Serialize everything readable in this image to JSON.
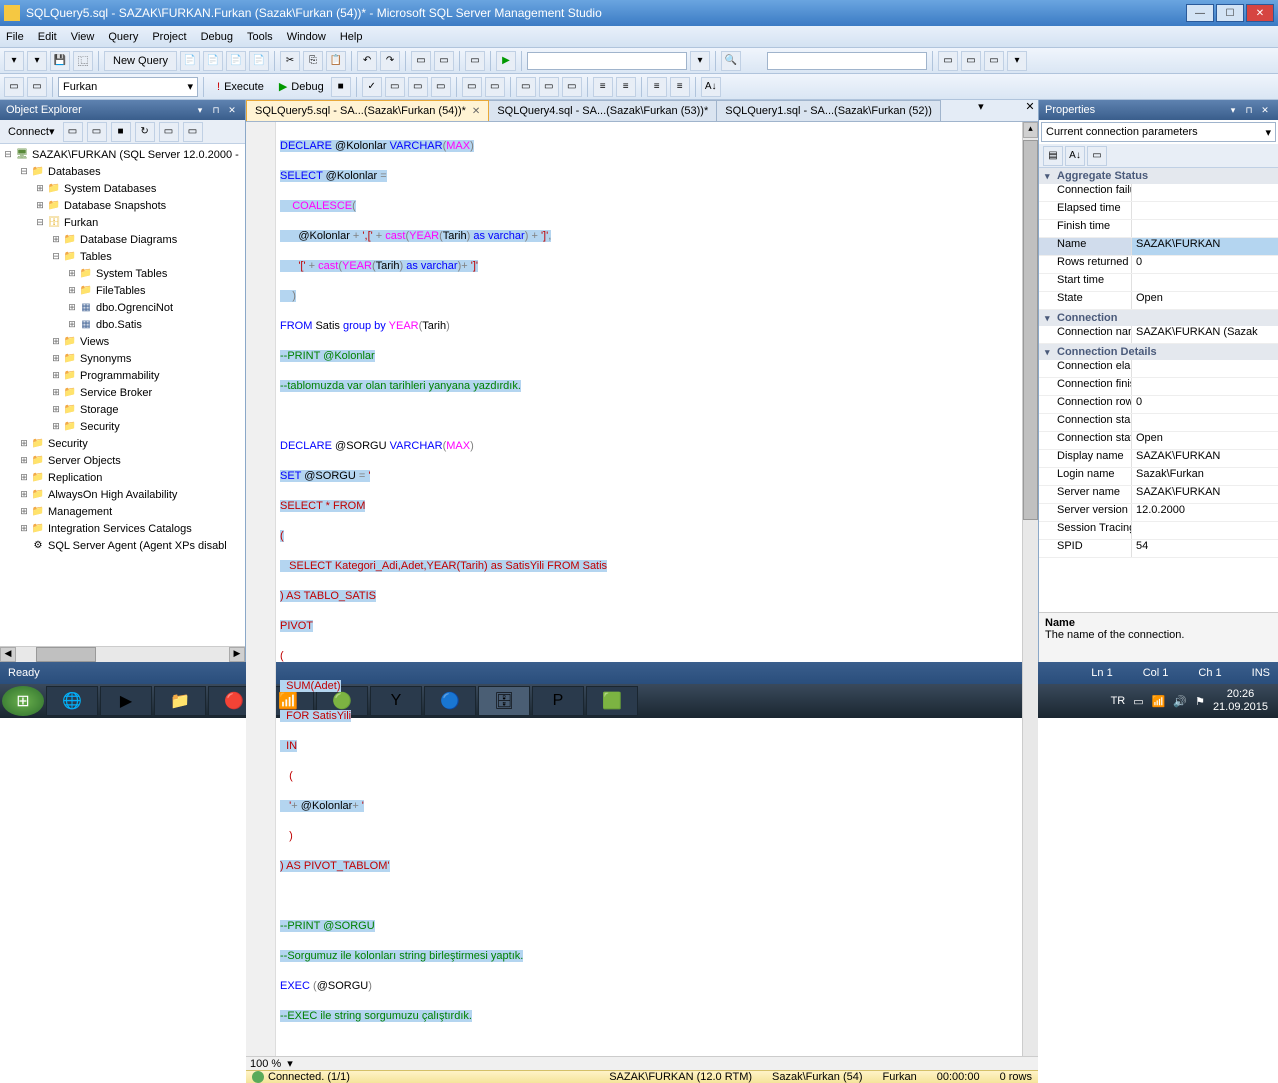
{
  "window": {
    "title": "SQLQuery5.sql - SAZAK\\FURKAN.Furkan (Sazak\\Furkan (54))* - Microsoft SQL Server Management Studio"
  },
  "menu": {
    "file": "File",
    "edit": "Edit",
    "view": "View",
    "query": "Query",
    "project": "Project",
    "debug": "Debug",
    "tools": "Tools",
    "window": "Window",
    "help": "Help"
  },
  "toolbar": {
    "newquery": "New Query",
    "database": "Furkan",
    "execute": "Execute",
    "debug": "Debug"
  },
  "objexplorer": {
    "title": "Object Explorer",
    "connect": "Connect",
    "server": "SAZAK\\FURKAN (SQL Server 12.0.2000 -",
    "databases": "Databases",
    "sysdb": "System Databases",
    "dbsnap": "Database Snapshots",
    "furkan": "Furkan",
    "dbdiagrams": "Database Diagrams",
    "tables": "Tables",
    "systables": "System Tables",
    "filetables": "FileTables",
    "ogrencinot": "dbo.OgrenciNot",
    "satis": "dbo.Satis",
    "views": "Views",
    "synonyms": "Synonyms",
    "programmability": "Programmability",
    "servicebroker": "Service Broker",
    "storage": "Storage",
    "security": "Security",
    "security2": "Security",
    "serverobjects": "Server Objects",
    "replication": "Replication",
    "alwayson": "AlwaysOn High Availability",
    "management": "Management",
    "isc": "Integration Services Catalogs",
    "agent": "SQL Server Agent (Agent XPs disabl"
  },
  "tabs": {
    "t1": "SQLQuery5.sql - SA...(Sazak\\Furkan (54))*",
    "t2": "SQLQuery4.sql - SA...(Sazak\\Furkan (53))*",
    "t3": "SQLQuery1.sql - SA...(Sazak\\Furkan (52))"
  },
  "code": {
    "l1a": "DECLARE",
    "l1b": " @Kolonlar ",
    "l1c": "VARCHAR",
    "l1d": "(",
    "l1e": "MAX",
    "l1f": ")",
    "l2a": "SELECT",
    "l2b": " @Kolonlar ",
    "l2c": "=",
    "l3a": "    COALESCE",
    "l3b": "(",
    "l4a": "      @Kolonlar ",
    "l4b": "+",
    "l4c": " ',['",
    "l4d": " + ",
    "l4e": "cast",
    "l4f": "(",
    "l4g": "YEAR",
    "l4h": "(",
    "l4i": "Tarih",
    "l4j": ")",
    "l4k": " as ",
    "l4l": "varchar",
    "l4m": ")",
    "l4n": " + ",
    "l4o": "']'",
    "l4p": ",",
    "l5a": "      '['",
    "l5b": " + ",
    "l5c": "cast",
    "l5d": "(",
    "l5e": "YEAR",
    "l5f": "(",
    "l5g": "Tarih",
    "l5h": ")",
    "l5i": " as ",
    "l5j": "varchar",
    "l5k": ")",
    "l5l": "+ ",
    "l5m": "']'",
    "l6a": "    )",
    "l7a": "FROM",
    "l7b": " Satis ",
    "l7c": "group",
    "l7d": " by ",
    "l7e": "YEAR",
    "l7f": "(",
    "l7g": "Tarih",
    "l7h": ")",
    "l8": "--PRINT @Kolonlar",
    "l9": "--tablomuzda var olan tarihleri yanyana yazdırdık.",
    "l11a": "DECLARE",
    "l11b": " @SORGU ",
    "l11c": "VARCHAR",
    "l11d": "(",
    "l11e": "MAX",
    "l11f": ")",
    "l12a": "SET",
    "l12b": " @SORGU ",
    "l12c": "=",
    "l12d": " '",
    "l13": "SELECT * FROM",
    "l14": "(",
    "l15": "   SELECT Kategori_Adi,Adet,YEAR(Tarih) as SatisYili FROM Satis",
    "l16a": ")",
    "l16b": " AS TABLO_SATIS",
    "l17": "PIVOT",
    "l18": "(",
    "l19": "  SUM(Adet)",
    "l20": "  FOR SatisYili",
    "l21": "  IN",
    "l22": "   (",
    "l23a": "   '",
    "l23b": "+",
    "l23c": " @Kolonlar",
    "l23d": "+",
    "l23e": " '",
    "l24": "   )",
    "l25a": ")",
    "l25b": " AS PIVOT_TABLOM",
    "l25c": "'",
    "l27": "--PRINT @SORGU",
    "l28": "--Sorgumuz ile kolonları string birleştirmesi yaptık.",
    "l29a": "EXEC",
    "l29b": " (",
    "l29c": "@SORGU",
    "l29d": ")",
    "l30": "--EXEC ile string sorgumuzu çalıştırdık."
  },
  "zoom": "100 %",
  "connstatus": {
    "connected": "Connected. (1/1)",
    "server": "SAZAK\\FURKAN (12.0 RTM)",
    "user": "Sazak\\Furkan (54)",
    "db": "Furkan",
    "time": "00:00:00",
    "rows": "0 rows"
  },
  "properties": {
    "title": "Properties",
    "combo": "Current connection parameters",
    "cat_agg": "Aggregate Status",
    "connfail": "Connection failure",
    "elapsed": "Elapsed time",
    "finish": "Finish time",
    "name": "Name",
    "name_v": "SAZAK\\FURKAN",
    "rowsret": "Rows returned",
    "rowsret_v": "0",
    "starttime": "Start time",
    "state": "State",
    "state_v": "Open",
    "cat_conn": "Connection",
    "connname": "Connection name",
    "connname_v": "SAZAK\\FURKAN (Sazak",
    "cat_cd": "Connection Details",
    "connelaps": "Connection elapsed",
    "connfin": "Connection finish",
    "connrows": "Connection rows",
    "connrows_v": "0",
    "connstart": "Connection start t",
    "connstate2": "Connection state",
    "connstate2_v": "Open",
    "dispname": "Display name",
    "dispname_v": "SAZAK\\FURKAN",
    "loginname": "Login name",
    "loginname_v": "Sazak\\Furkan",
    "servername": "Server name",
    "servername_v": "SAZAK\\FURKAN",
    "serverver": "Server version",
    "serverver_v": "12.0.2000",
    "sesstrace": "Session Tracing ID",
    "spid": "SPID",
    "spid_v": "54",
    "desc_name": "Name",
    "desc_text": "The name of the connection."
  },
  "statusbar": {
    "ready": "Ready",
    "ln": "Ln 1",
    "col": "Col 1",
    "ch": "Ch 1",
    "ins": "INS"
  },
  "tray": {
    "lang": "TR",
    "time": "20:26",
    "date": "21.09.2015"
  }
}
